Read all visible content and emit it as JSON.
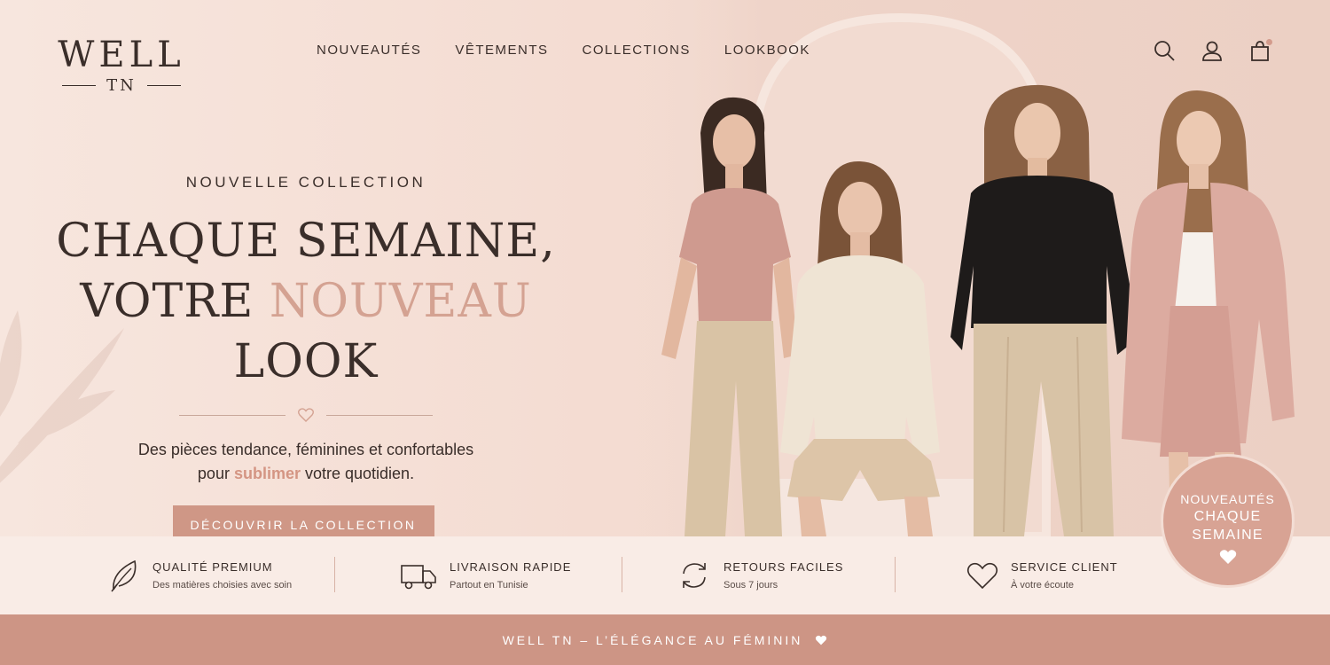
{
  "brand": {
    "name": "WELL",
    "sub": "TN"
  },
  "nav": {
    "items": [
      {
        "label": "NOUVEAUTÉS"
      },
      {
        "label": "VÊTEMENTS"
      },
      {
        "label": "COLLECTIONS"
      },
      {
        "label": "LOOKBOOK"
      }
    ]
  },
  "header_icons": [
    "search-icon",
    "user-icon",
    "shopping-bag-icon"
  ],
  "hero": {
    "eyebrow": "NOUVELLE COLLECTION",
    "headline_line1": "CHAQUE SEMAINE,",
    "headline_pre": "VOTRE ",
    "headline_accent": "NOUVEAU",
    "headline_post": " LOOK",
    "subtitle_line1": "Des pièces tendance, féminines et confortables",
    "subtitle_pre": "pour ",
    "subtitle_accent": "sublimer",
    "subtitle_post": " votre quotidien.",
    "cta_label": "DÉCOUVRIR LA COLLECTION"
  },
  "badge": {
    "line1": "NOUVEAUTÉS",
    "line2": "CHAQUE",
    "line3": "SEMAINE"
  },
  "features": [
    {
      "icon": "leaf-icon",
      "title": "QUALITÉ PREMIUM",
      "subtitle": "Des matières choisies avec soin"
    },
    {
      "icon": "truck-icon",
      "title": "LIVRAISON RAPIDE",
      "subtitle": "Partout en Tunisie"
    },
    {
      "icon": "refresh-icon",
      "title": "RETOURS FACILES",
      "subtitle": "Sous 7 jours"
    },
    {
      "icon": "heart-icon",
      "title": "SERVICE CLIENT",
      "subtitle": "À votre écoute"
    }
  ],
  "footer": {
    "text": "WELL TN – L’ÉLÉGANCE AU FÉMININ"
  },
  "colors": {
    "accent": "#cf9786",
    "background": "#f6e4db",
    "text": "#3a2e2a"
  }
}
